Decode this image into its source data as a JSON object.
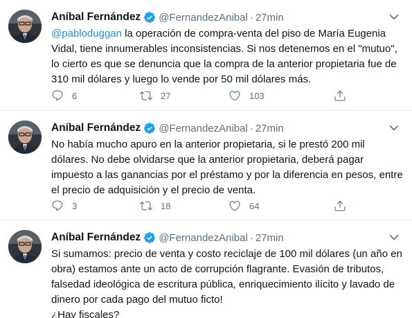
{
  "tweets": [
    {
      "author_name": "Aníbal Fernández",
      "handle": "@FernandezAnibal",
      "separator": "·",
      "time": "27min",
      "mention": "@pabloduggan",
      "lines": [
        " la operación de compra-venta del piso de María Eugenia",
        "Vidal, tiene innumerables inconsistencias. Si nos detenemos en el \"mutuo\",",
        "lo cierto es que se denuncia que la compra de la anterior propietaria fue de",
        "310 mil dólares y luego lo vende por 50 mil dólares más."
      ],
      "replies": "6",
      "retweets": "27",
      "likes": "103"
    },
    {
      "author_name": "Aníbal Fernández",
      "handle": "@FernandezAnibal",
      "separator": "·",
      "time": "27min",
      "lines": [
        "No había mucho apuro en la anterior propietaria, si le prestó 200 mil",
        "dólares. No debe olvidarse que la anterior propietaria, deberá pagar",
        "impuesto a las ganancias por el préstamo y por la diferencia en pesos, entre",
        "el precio de adquisición y el precio de venta."
      ],
      "replies": "3",
      "retweets": "18",
      "likes": "64"
    },
    {
      "author_name": "Aníbal Fernández",
      "handle": "@FernandezAnibal",
      "separator": "·",
      "time": "27min",
      "lines": [
        "Si sumamos: precio de venta y costo reciclaje de 100 mil dólares (un año en",
        "obra) estamos ante un acto de corrupción flagrante. Evasión de tributos,",
        "falsedad ideológica de escritura pública, enriquecimiento ilícito y lavado de",
        "dinero por cada pago del mutuo ficto!",
        "¿Hay fiscales?"
      ]
    }
  ],
  "icons": {
    "verified": "verified-badge-icon",
    "more": "more-options-icon",
    "reply": "reply-icon",
    "retweet": "retweet-icon",
    "like": "heart-icon",
    "share": "share-icon"
  },
  "colors": {
    "text": "#0f1419",
    "secondary": "#5b7083",
    "link": "#1b95e0",
    "verified": "#1da1f2",
    "divider": "#e6ecf0"
  }
}
